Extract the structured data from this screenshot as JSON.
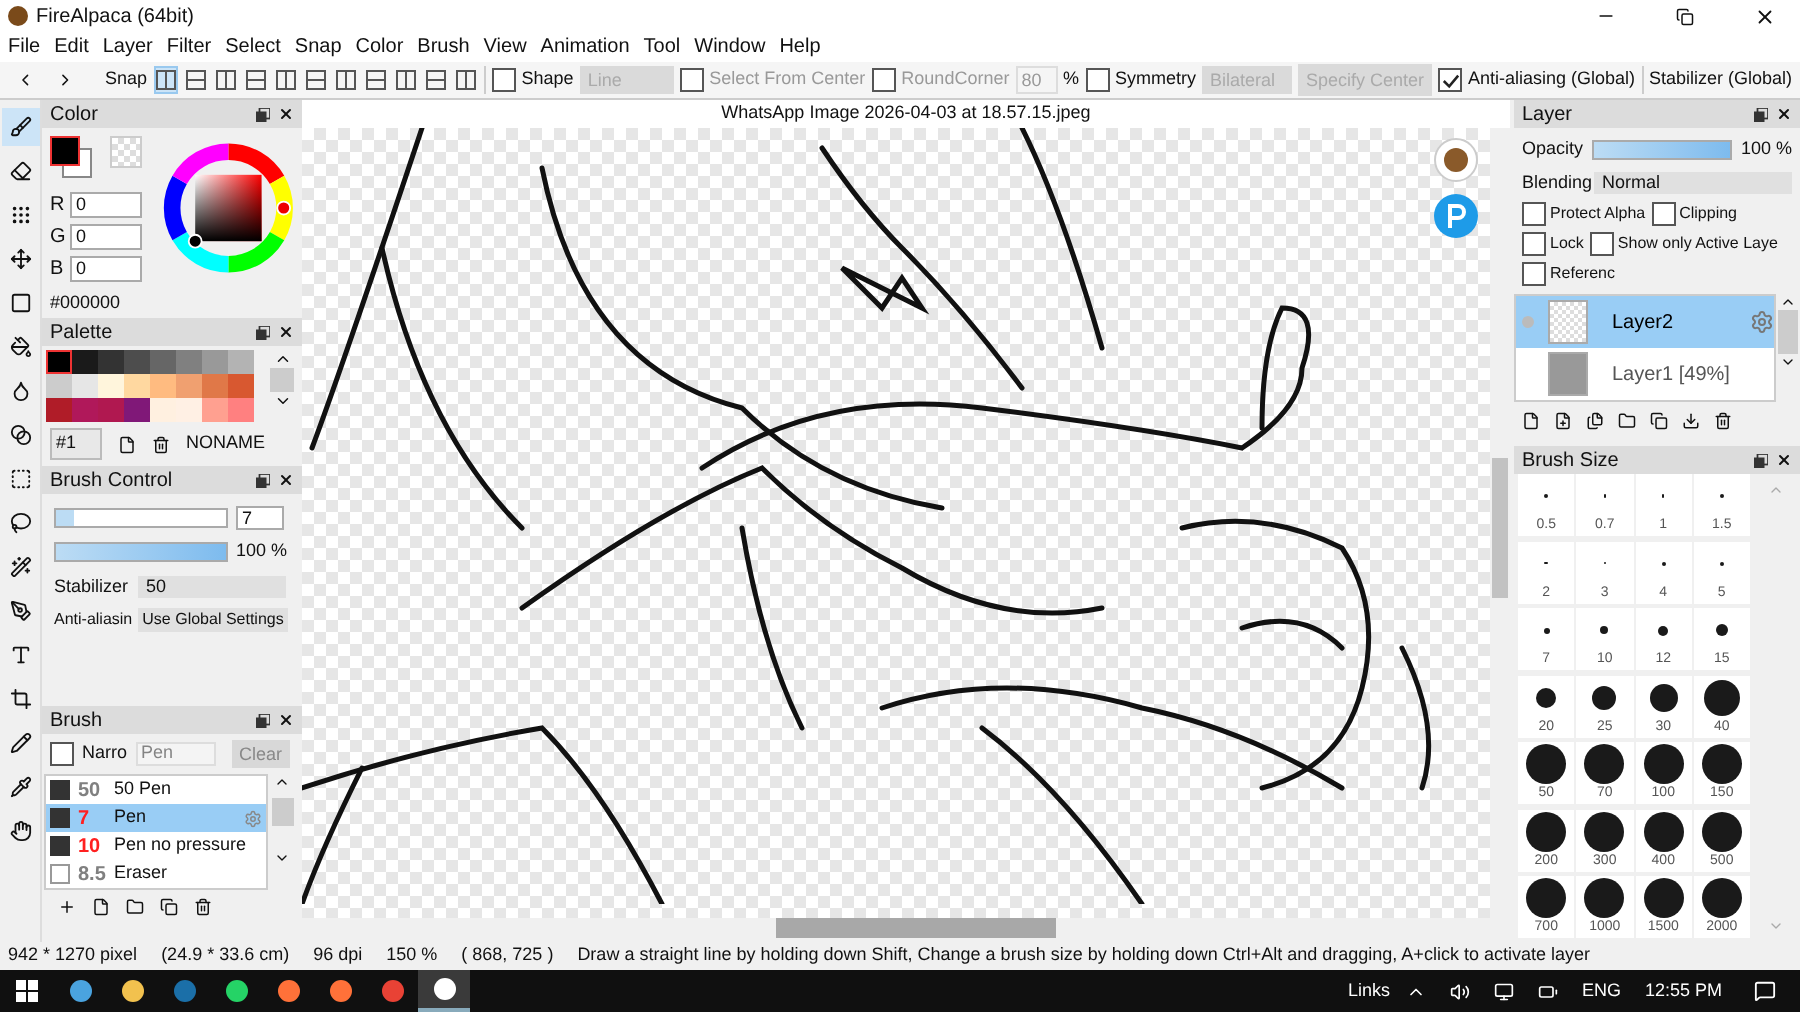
{
  "title_bar": {
    "title": "FireAlpaca (64bit)"
  },
  "menu": [
    "File",
    "Edit",
    "Layer",
    "Filter",
    "Select",
    "Snap",
    "Color",
    "Brush",
    "View",
    "Animation",
    "Tool",
    "Window",
    "Help"
  ],
  "toolbar": {
    "snap_label": "Snap",
    "snap_modes": [
      {
        "selected": true
      },
      {
        "selected": false
      },
      {
        "selected": false
      },
      {
        "selected": false
      },
      {
        "selected": false
      },
      {
        "selected": false
      },
      {
        "selected": false
      },
      {
        "selected": false
      },
      {
        "selected": false
      },
      {
        "selected": false
      },
      {
        "selected": false
      }
    ],
    "shape": {
      "label": "Shape",
      "checked": false,
      "value": "Line"
    },
    "select_from_center": {
      "label": "Select From Center",
      "checked": false
    },
    "round_corner": {
      "label": "RoundCorner",
      "checked": false,
      "value": "80",
      "unit": "%"
    },
    "symmetry": {
      "label": "Symmetry",
      "checked": false,
      "value": "Bilateral"
    },
    "specify_center": "Specify Center",
    "anti_aliasing": {
      "label": "Anti-aliasing (Global)",
      "checked": true
    },
    "stabilizer": "Stabilizer (Global)"
  },
  "tools": [
    {
      "kind": "brush",
      "selected": true
    },
    {
      "kind": "eraser",
      "selected": false
    },
    {
      "kind": "dots",
      "selected": false
    },
    {
      "kind": "move",
      "selected": false
    },
    {
      "kind": "rect",
      "selected": false
    },
    {
      "kind": "bucket",
      "selected": false
    },
    {
      "kind": "fill",
      "selected": false
    },
    {
      "kind": "gradient",
      "selected": false
    },
    {
      "kind": "select",
      "selected": false
    },
    {
      "kind": "lasso",
      "selected": false
    },
    {
      "kind": "wand",
      "selected": false
    },
    {
      "kind": "selpen",
      "selected": false
    },
    {
      "kind": "text",
      "selected": false
    },
    {
      "kind": "crop",
      "selected": false
    },
    {
      "kind": "pen",
      "selected": false
    },
    {
      "kind": "dropper",
      "selected": false
    },
    {
      "kind": "hand",
      "selected": false
    }
  ],
  "color_panel": {
    "title": "Color",
    "r_label": "R",
    "r": "0",
    "g_label": "G",
    "g": "0",
    "b_label": "B",
    "b": "0",
    "hex": "#000000"
  },
  "palette": {
    "title": "Palette",
    "set": "#1",
    "name": "NONAME",
    "swatches": [
      {
        "color": "#000000",
        "selected": true
      },
      {
        "color": "#1a1a1a",
        "selected": false
      },
      {
        "color": "#333333",
        "selected": false
      },
      {
        "color": "#4d4d4d",
        "selected": false
      },
      {
        "color": "#666666",
        "selected": false
      },
      {
        "color": "#808080",
        "selected": false
      },
      {
        "color": "#999999",
        "selected": false
      },
      {
        "color": "#b3b3b3",
        "selected": false
      },
      {
        "color": "#cccccc",
        "selected": false
      },
      {
        "color": "#e6e6e6",
        "selected": false
      },
      {
        "color": "#fff5dc",
        "selected": false
      },
      {
        "color": "#ffd8a0",
        "selected": false
      },
      {
        "color": "#ffbb80",
        "selected": false
      },
      {
        "color": "#f0a070",
        "selected": false
      },
      {
        "color": "#e07848",
        "selected": false
      },
      {
        "color": "#d85830",
        "selected": false
      },
      {
        "color": "#b01c28",
        "selected": false
      },
      {
        "color": "#b0185a",
        "selected": false
      },
      {
        "color": "#b01850",
        "selected": false
      },
      {
        "color": "#801878",
        "selected": false
      },
      {
        "color": "#fff0e0",
        "selected": false
      },
      {
        "color": "#fff0e4",
        "selected": false
      },
      {
        "color": "#ffa090",
        "selected": false
      },
      {
        "color": "#ff8080",
        "selected": false
      }
    ]
  },
  "brush_control": {
    "title": "Brush Control",
    "size": "7",
    "size_slider": {
      "level": 0.1
    },
    "opacity_slider": {
      "level": 1
    },
    "opacity": "100 %",
    "stabilizer_label": "Stabilizer",
    "stabilizer": "50",
    "anti_alias_label": "Anti-aliasin",
    "anti_alias": "Use Global Settings"
  },
  "brush": {
    "title": "Brush",
    "narrow": {
      "label": "Narro",
      "checked": false
    },
    "filter_placeholder": "Pen",
    "clear": "Clear",
    "items": [
      {
        "kind": "pen",
        "size": "50",
        "name": "50 Pen",
        "color": "#808080",
        "selected": false
      },
      {
        "kind": "pen",
        "size": "7",
        "name": "Pen",
        "color": "#ff2020",
        "selected": true
      },
      {
        "kind": "pen",
        "size": "10",
        "name": "Pen no pressure",
        "color": "#ff2020",
        "selected": false
      },
      {
        "kind": "eraser",
        "size": "8.5",
        "name": "Eraser",
        "color": "#808080",
        "selected": false
      }
    ]
  },
  "canvas": {
    "title": "WhatsApp Image 2026-04-03 at 18.57.15.jpeg"
  },
  "layer_panel": {
    "title": "Layer",
    "opacity_label": "Opacity",
    "opacity_slider": {
      "level": 1
    },
    "opacity": "100 %",
    "blending_label": "Blending",
    "blending": "Normal",
    "options": [
      {
        "label": "Protect Alpha",
        "checked": false
      },
      {
        "label": "Clipping",
        "checked": false
      },
      {
        "label": "Lock",
        "checked": false
      },
      {
        "label": "Show only Active Laye",
        "checked": false
      },
      {
        "label": "Referenc",
        "checked": false
      }
    ],
    "layers": [
      {
        "name": "Layer2",
        "selected": true
      },
      {
        "name": "Layer1 [49%]",
        "selected": false
      }
    ]
  },
  "brush_size": {
    "title": "Brush Size",
    "sizes": [
      "0.5",
      "0.7",
      "1",
      "1.5",
      "2",
      "3",
      "4",
      "5",
      "7",
      "10",
      "12",
      "15",
      "20",
      "25",
      "30",
      "40",
      "50",
      "70",
      "100",
      "150",
      "200",
      "300",
      "400",
      "500",
      "700",
      "1000",
      "1500",
      "2000"
    ]
  },
  "status_bar": {
    "pixels": "942 * 1270 pixel",
    "cm": "(24.9 * 33.6 cm)",
    "dpi": "96 dpi",
    "zoom": "150 %",
    "coords": "( 868, 725 )",
    "hint": "Draw a straight line by holding down Shift, Change a brush size by holding down Ctrl+Alt and dragging, A+click to activate layer"
  },
  "taskbar": {
    "apps": [
      {
        "kind": "store",
        "selected": false
      },
      {
        "kind": "folder",
        "selected": false
      },
      {
        "kind": "steam",
        "selected": false
      },
      {
        "kind": "chat",
        "selected": false
      },
      {
        "kind": "firefox",
        "selected": false
      },
      {
        "kind": "firefox",
        "selected": false
      },
      {
        "kind": "chrome",
        "selected": false
      },
      {
        "kind": "alpaca",
        "selected": true
      }
    ],
    "links": "Links",
    "lang": "ENG",
    "time": "12:55 PM"
  }
}
